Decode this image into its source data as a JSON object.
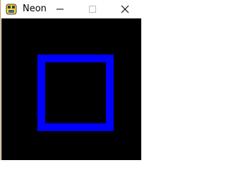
{
  "window": {
    "title": "Neon",
    "app_icon": "python-icon",
    "controls": {
      "minimize_icon": "minimize-icon",
      "maximize_icon": "maximize-icon",
      "close_icon": "close-icon"
    }
  },
  "canvas": {
    "background": "#000000",
    "shape": {
      "type": "square-outline",
      "stroke_color": "#0000ff"
    }
  }
}
